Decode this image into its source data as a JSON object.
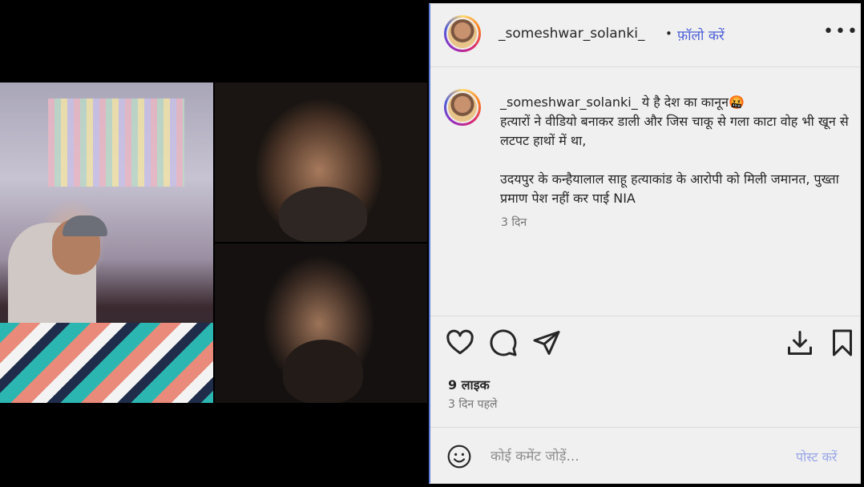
{
  "post": {
    "username": "_someshwar_solanki_",
    "separator": "•",
    "follow_label": "फ़ॉलो करें",
    "more_label": "•••"
  },
  "caption": {
    "username": "_someshwar_solanki_",
    "line1": "ये है देश का कानून🤬",
    "line2": "हत्यारों ने वीडियो बनाकर डाली और जिस चाकू से गला काटा वोह भी खून से लटपट हाथों में था,",
    "line3": "उदयपुर के कन्हैयालाल साहू हत्याकांड के आरोपी को मिली जमानत, पुख्ता प्रमाण पेश नहीं कर पाई NIA",
    "time": "3 दिन"
  },
  "stats": {
    "likes": "9 लाइक",
    "posted_ago": "3 दिन पहले"
  },
  "comment": {
    "placeholder": "कोई कमेंट जोड़ें...",
    "post_label": "पोस्ट करें"
  },
  "icons": [
    "heart-icon",
    "comment-icon",
    "share-icon",
    "download-icon",
    "bookmark-icon",
    "emoji-icon"
  ],
  "colors": {
    "link": "#4b5fd6",
    "muted": "#737373",
    "post_disabled": "#9aa7e6"
  }
}
